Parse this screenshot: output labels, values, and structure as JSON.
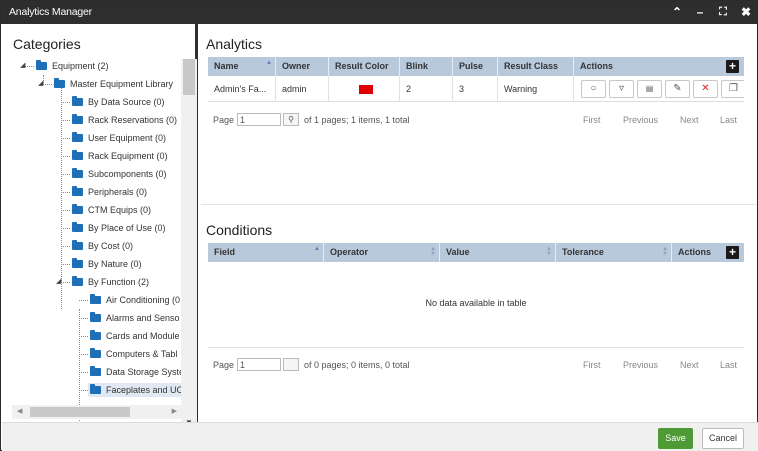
{
  "window": {
    "title": "Analytics Manager"
  },
  "categories": {
    "title": "Categories",
    "tree": [
      {
        "label": "Equipment (2)"
      },
      {
        "label": "Master Equipment Library"
      },
      {
        "label": "By Data Source (0)"
      },
      {
        "label": "Rack Reservations (0)"
      },
      {
        "label": "User Equipment (0)"
      },
      {
        "label": "Rack Equipment (0)"
      },
      {
        "label": "Subcomponents (0)"
      },
      {
        "label": "Peripherals (0)"
      },
      {
        "label": "CTM Equips (0)"
      },
      {
        "label": "By Place of Use (0)"
      },
      {
        "label": "By Cost (0)"
      },
      {
        "label": "By Nature (0)"
      },
      {
        "label": "By Function (2)"
      },
      {
        "label": "Air Conditioning (0"
      },
      {
        "label": "Alarms and Senso"
      },
      {
        "label": "Cards and Module"
      },
      {
        "label": "Computers & Tabl"
      },
      {
        "label": "Data Storage Syste"
      },
      {
        "label": "Faceplates and UC"
      }
    ]
  },
  "analytics": {
    "title": "Analytics",
    "columns": [
      "Name",
      "Owner",
      "Result Color",
      "Blink",
      "Pulse",
      "Result Class",
      "Actions"
    ],
    "row": {
      "name": "Admin's Fa...",
      "owner": "admin",
      "result_color": "#e00000",
      "blink": "2",
      "pulse": "3",
      "result_class": "Warning"
    },
    "action_icons": [
      "circle-icon",
      "filter-icon",
      "device-icon",
      "edit-icon",
      "delete-icon",
      "copy-icon"
    ],
    "pager": {
      "page_label": "Page",
      "page_value": "1",
      "info": "of 1 pages; 1 items, 1 total",
      "first": "First",
      "previous": "Previous",
      "next": "Next",
      "last": "Last"
    }
  },
  "conditions": {
    "title": "Conditions",
    "columns": [
      "Field",
      "Operator",
      "Value",
      "Tolerance",
      "Actions"
    ],
    "empty": "No data available in table",
    "pager": {
      "page_label": "Page",
      "page_value": "1",
      "info": "of 0 pages; 0 items, 0 total",
      "first": "First",
      "previous": "Previous",
      "next": "Next",
      "last": "Last"
    }
  },
  "footer": {
    "save": "Save",
    "cancel": "Cancel"
  },
  "colors": {
    "titlebar": "#2e2e2e",
    "header": "#b9c9dc",
    "folder": "#1d6fb8",
    "save": "#4e9a34"
  }
}
